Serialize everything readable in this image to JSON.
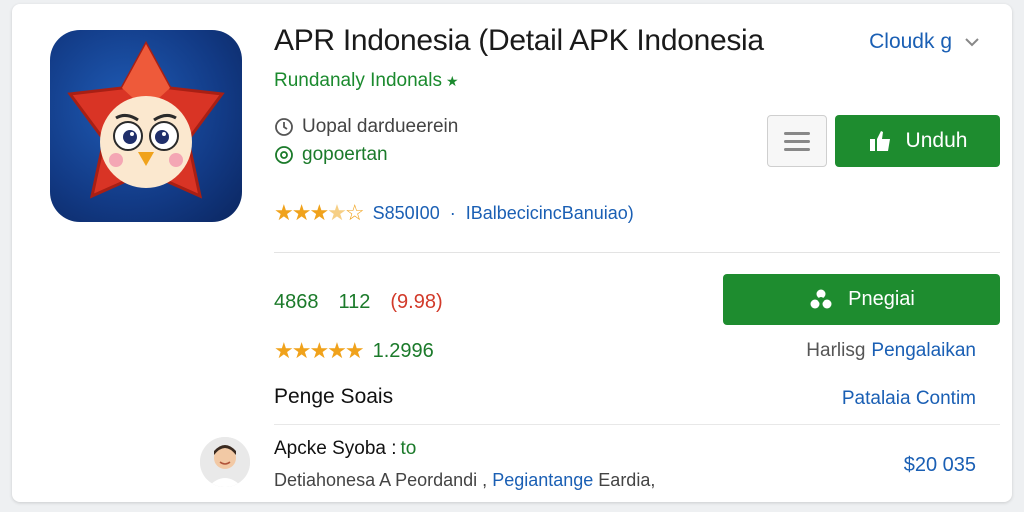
{
  "app": {
    "title": "APR Indonesia (Detail APK Indonesia",
    "developer": "Rundanaly Indonals",
    "meta_line1": "Uopal dardueerein",
    "meta_line2": "gopoertan",
    "rating_count": "S850I00",
    "rating_separator": "·",
    "rating_link": "IBalbecicincBanuiao)",
    "stars": 3.5
  },
  "header": {
    "top_link": "Cloudk g"
  },
  "actions": {
    "download_label": "Unduh",
    "secondary_label": "Pnegiai"
  },
  "stats": {
    "a": "4868",
    "b": "112",
    "c": "(9.98)",
    "rating_value": "1.2996",
    "stars": 5
  },
  "links": {
    "harlisg_gray": "Harlisg",
    "harlisg_blue": "Pengalaikan"
  },
  "section": {
    "title": "Penge Soais",
    "link": "Patalaia Contim"
  },
  "review": {
    "name": "Apcke Syoba :",
    "tag": "to",
    "text_prefix": "Detiahonesa A Peordandi ,",
    "text_link": "Pegiantange",
    "text_suffix": "Eardia,",
    "price": "$20 035"
  },
  "colors": {
    "accent_green": "#1e8c2f",
    "link_blue": "#1a5fb4",
    "star_orange": "#f0a21b",
    "negative_red": "#d23a2a"
  },
  "icons": {
    "app_icon": "red-star-owl-icon",
    "meta1": "clock-icon",
    "meta2": "at-icon",
    "download": "thumb-up-icon",
    "secondary": "gear-icon",
    "menu": "hamburger-icon",
    "chevron": "chevron-down-icon"
  }
}
